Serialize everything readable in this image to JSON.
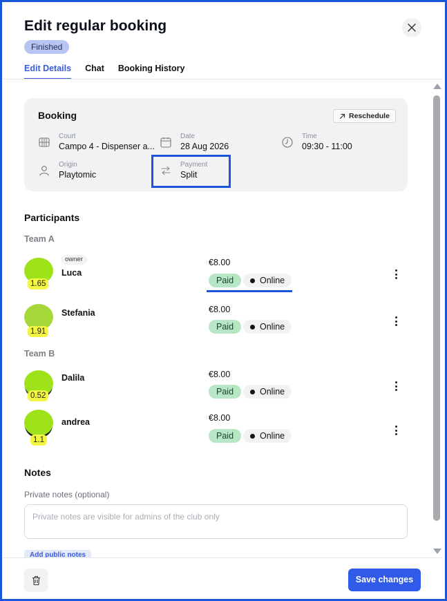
{
  "header": {
    "title": "Edit regular booking",
    "status": "Finished"
  },
  "tabs": [
    {
      "label": "Edit Details",
      "active": true
    },
    {
      "label": "Chat",
      "active": false
    },
    {
      "label": "Booking History",
      "active": false
    }
  ],
  "booking": {
    "title": "Booking",
    "reschedule_label": "Reschedule",
    "court": {
      "label": "Court",
      "value": "Campo 4 - Dispenser a..."
    },
    "date": {
      "label": "Date",
      "value": "28 Aug 2026"
    },
    "time": {
      "label": "Time",
      "value": "09:30 - 11:00"
    },
    "origin": {
      "label": "Origin",
      "value": "Playtomic"
    },
    "payment": {
      "label": "Payment",
      "value": "Split"
    }
  },
  "participants": {
    "title": "Participants",
    "teams": [
      {
        "label": "Team A",
        "players": [
          {
            "name": "Luca",
            "rating": "1.65",
            "owner_tag": "owner",
            "price": "€8.00",
            "status": "Paid",
            "method": "Online"
          },
          {
            "name": "Stefania",
            "rating": "1.91",
            "price": "€8.00",
            "status": "Paid",
            "method": "Online"
          }
        ]
      },
      {
        "label": "Team B",
        "players": [
          {
            "name": "Dalila",
            "rating": "0.52",
            "price": "€8.00",
            "status": "Paid",
            "method": "Online"
          },
          {
            "name": "andrea",
            "rating": "1.1",
            "price": "€8.00",
            "status": "Paid",
            "method": "Online"
          }
        ]
      }
    ]
  },
  "notes": {
    "title": "Notes",
    "private_label": "Private notes (optional)",
    "private_placeholder": "Private notes are visible for admins of the club only",
    "add_public_label": "Add public notes"
  },
  "footer": {
    "save_label": "Save changes"
  },
  "icons": {
    "close": "close-icon",
    "reschedule": "arrow-up-right-icon",
    "court": "court-grid-icon",
    "date": "calendar-icon",
    "time": "clock-icon",
    "origin": "user-icon",
    "payment": "swap-arrows-icon",
    "more": "kebab-menu-icon",
    "delete": "trash-icon"
  },
  "colors": {
    "accent": "#2f5be8",
    "status_badge": "#b8c4f2",
    "paid_badge": "#b6e6c4",
    "avatar": "#9ee21a",
    "rating_badge": "#f2f542",
    "highlight": "#1a56db"
  }
}
